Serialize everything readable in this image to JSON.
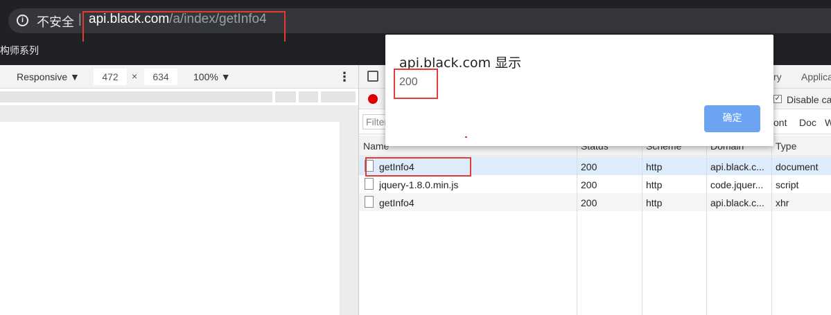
{
  "address_bar": {
    "security_label": "不安全",
    "separator": "|",
    "url_host": "api.black.com",
    "url_path": "/a/index/getInfo4"
  },
  "bookmarks": {
    "item": "构师系列"
  },
  "device_toolbar": {
    "mode": "Responsive ▼",
    "width": "472",
    "times": "×",
    "height": "634",
    "zoom": "100% ▼",
    "more": "⋮"
  },
  "devtools": {
    "tabs": {
      "history_partial": "ry",
      "application_partial": "Applica"
    },
    "toolbar": {
      "disable_cache_label": "Disable ca",
      "disable_cache_checked": true
    },
    "filter": {
      "placeholder": "Filter",
      "types": [
        "ont",
        "Doc",
        "W"
      ]
    },
    "columns": [
      "Name",
      "Status",
      "Scheme",
      "Domain",
      "Type"
    ],
    "rows": [
      {
        "name": "getInfo4",
        "status": "200",
        "scheme": "http",
        "domain": "api.black.c...",
        "type": "document"
      },
      {
        "name": "jquery-1.8.0.min.js",
        "status": "200",
        "scheme": "http",
        "domain": "code.jquer...",
        "type": "script"
      },
      {
        "name": "getInfo4",
        "status": "200",
        "scheme": "http",
        "domain": "api.black.c...",
        "type": "xhr"
      }
    ]
  },
  "dialog": {
    "title": "api.black.com 显示",
    "message": "200",
    "ok_label": "确定"
  },
  "colors": {
    "highlight": "#e53935",
    "button": "#6ba5f2",
    "selected_row": "#deebfa",
    "record": "#e00000"
  }
}
